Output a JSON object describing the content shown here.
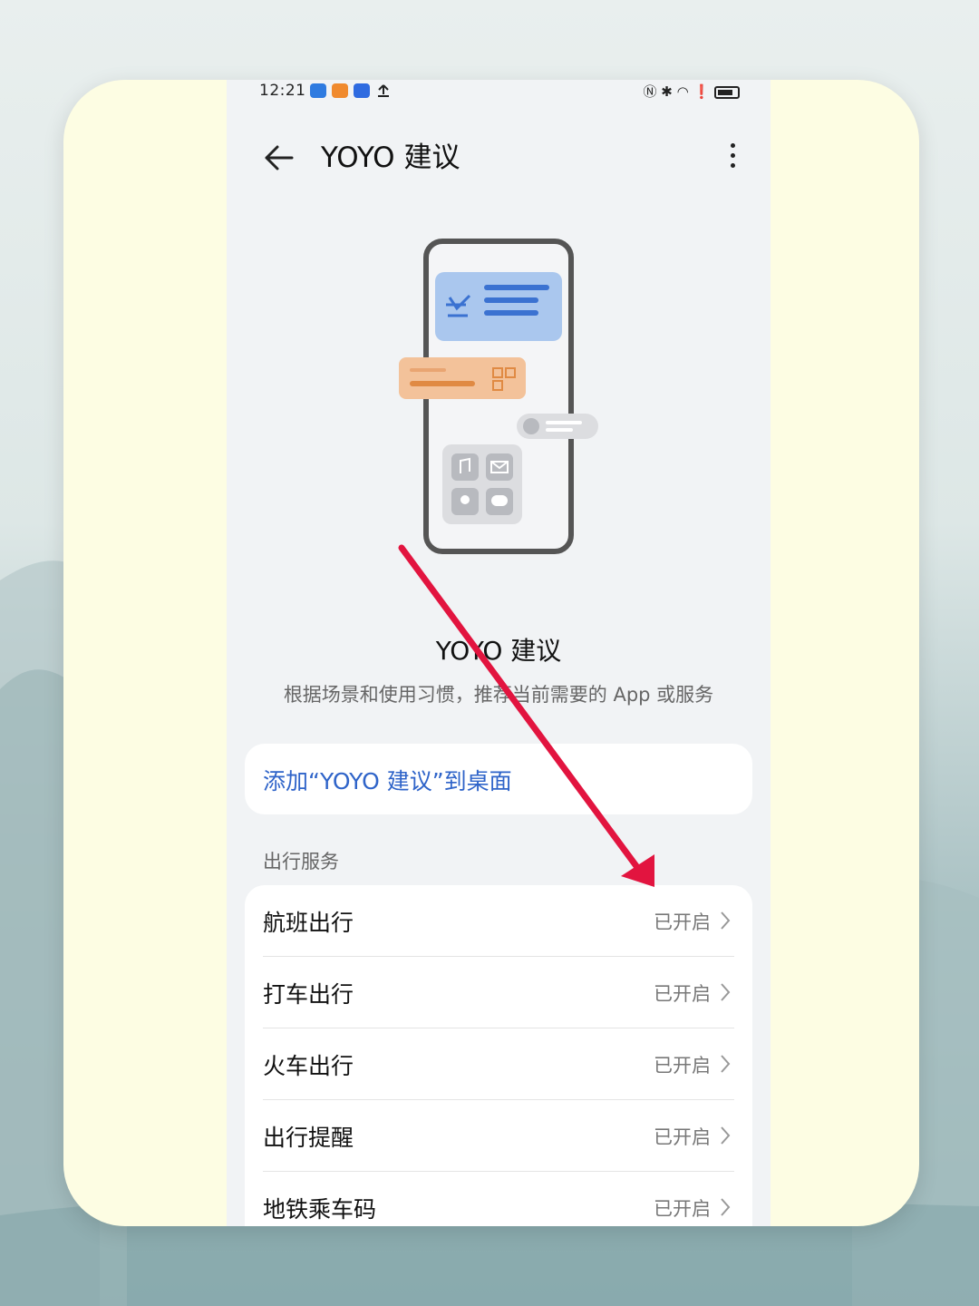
{
  "status_bar": {
    "time": "12:21"
  },
  "header": {
    "title": "YOYO 建议",
    "back_icon": "arrow-left-icon",
    "more_icon": "more-vertical-icon"
  },
  "intro": {
    "title": "YOYO 建议",
    "description": "根据场景和使用习惯，推荐当前需要的 App 或服务"
  },
  "add_to_desktop": {
    "label": "添加“YOYO 建议”到桌面"
  },
  "section": {
    "label": "出行服务"
  },
  "services": [
    {
      "label": "航班出行",
      "status": "已开启"
    },
    {
      "label": "打车出行",
      "status": "已开启"
    },
    {
      "label": "火车出行",
      "status": "已开启"
    },
    {
      "label": "出行提醒",
      "status": "已开启"
    },
    {
      "label": "地铁乘车码",
      "status": "已开启"
    }
  ],
  "colors": {
    "accent_link": "#2f64c9",
    "annotation_arrow": "#e2143f",
    "card_background": "#fdfde3"
  }
}
